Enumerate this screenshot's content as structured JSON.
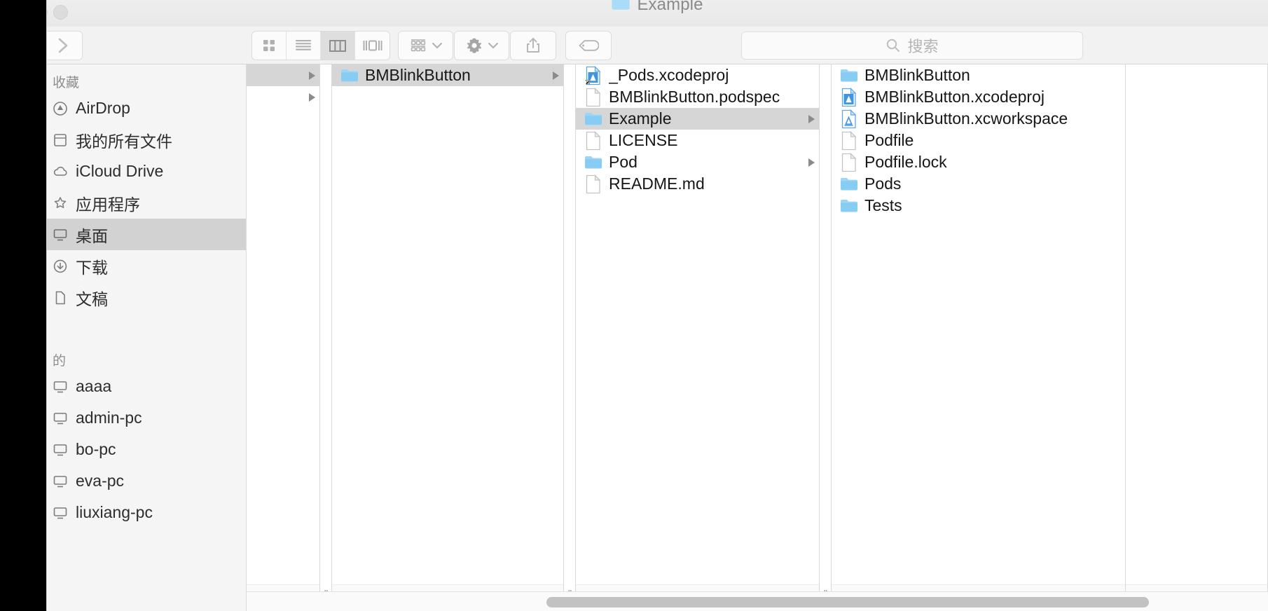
{
  "window": {
    "title": "Example",
    "title_icon": "folder-icon",
    "traffic_lights": [
      "close-button",
      "minimize-button",
      "zoom-button"
    ]
  },
  "toolbar": {
    "back_label": "›",
    "back_icon": "chevron-right-icon",
    "view_modes": [
      {
        "name": "icon-view",
        "icon": "grid-icon",
        "active": false
      },
      {
        "name": "list-view",
        "icon": "list-icon",
        "active": false
      },
      {
        "name": "column-view",
        "icon": "columns-icon",
        "active": true
      },
      {
        "name": "gallery-view",
        "icon": "gallery-icon",
        "active": false
      }
    ],
    "arrange_icon": "arrange-icon",
    "action_icon": "gear-icon",
    "share_icon": "share-icon",
    "tag_icon": "tag-icon",
    "chevron_icon": "chevron-down-icon"
  },
  "search": {
    "placeholder": "搜索",
    "value": "",
    "icon": "search-icon"
  },
  "sidebar": {
    "sections": [
      {
        "title": "收藏",
        "items": [
          {
            "label": "AirDrop",
            "icon": "airdrop-icon",
            "selected": false
          },
          {
            "label": "我的所有文件",
            "icon": "all-files-icon",
            "selected": false
          },
          {
            "label": "iCloud Drive",
            "icon": "icloud-icon",
            "selected": false
          },
          {
            "label": "应用程序",
            "icon": "applications-icon",
            "selected": false
          },
          {
            "label": "桌面",
            "icon": "desktop-icon",
            "selected": true
          },
          {
            "label": "下载",
            "icon": "downloads-icon",
            "selected": false
          },
          {
            "label": "文稿",
            "icon": "documents-icon",
            "selected": false
          }
        ]
      },
      {
        "title": "的",
        "items": [
          {
            "label": "aaaa",
            "icon": "shared-computer-icon",
            "selected": false
          },
          {
            "label": "admin-pc",
            "icon": "shared-computer-icon",
            "selected": false
          },
          {
            "label": "bo-pc",
            "icon": "shared-computer-icon",
            "selected": false
          },
          {
            "label": "eva-pc",
            "icon": "shared-computer-icon",
            "selected": false
          },
          {
            "label": "liuxiang-pc",
            "icon": "shared-computer-icon",
            "selected": false
          }
        ]
      }
    ]
  },
  "columns": [
    {
      "name": "column-1",
      "rows": [
        {
          "label": "",
          "icon": "none",
          "selected": true,
          "has_children": true
        },
        {
          "label": "",
          "icon": "none",
          "selected": false,
          "has_children": true
        }
      ]
    },
    {
      "name": "column-2",
      "rows": [
        {
          "label": "BMBlinkButton",
          "icon": "folder-icon",
          "selected": true,
          "has_children": true
        }
      ]
    },
    {
      "name": "column-3",
      "rows": [
        {
          "label": "_Pods.xcodeproj",
          "icon": "xcodeproj-alias-icon",
          "selected": false,
          "has_children": false
        },
        {
          "label": "BMBlinkButton.podspec",
          "icon": "document-icon",
          "selected": false,
          "has_children": false
        },
        {
          "label": "Example",
          "icon": "folder-icon",
          "selected": true,
          "has_children": true
        },
        {
          "label": "LICENSE",
          "icon": "document-icon",
          "selected": false,
          "has_children": false
        },
        {
          "label": "Pod",
          "icon": "folder-icon",
          "selected": false,
          "has_children": true
        },
        {
          "label": "README.md",
          "icon": "document-icon",
          "selected": false,
          "has_children": false
        }
      ]
    },
    {
      "name": "column-4",
      "rows": [
        {
          "label": "BMBlinkButton",
          "icon": "folder-icon",
          "selected": false,
          "has_children": false
        },
        {
          "label": "BMBlinkButton.xcodeproj",
          "icon": "xcodeproj-icon",
          "selected": false,
          "has_children": false
        },
        {
          "label": "BMBlinkButton.xcworkspace",
          "icon": "xcworkspace-icon",
          "selected": false,
          "has_children": false
        },
        {
          "label": "Podfile",
          "icon": "document-icon",
          "selected": false,
          "has_children": false
        },
        {
          "label": "Podfile.lock",
          "icon": "document-icon",
          "selected": false,
          "has_children": false
        },
        {
          "label": "Pods",
          "icon": "folder-icon",
          "selected": false,
          "has_children": false
        },
        {
          "label": "Tests",
          "icon": "folder-icon",
          "selected": false,
          "has_children": false
        }
      ]
    }
  ],
  "grips": {
    "mark": "‖"
  },
  "colors": {
    "folder_blue": "#87cdf3",
    "selection_gray": "#d6d6d6",
    "sidebar_bg": "#f5f5f5",
    "toolbar_bg": "#f2f2f2",
    "text": "#161616"
  }
}
